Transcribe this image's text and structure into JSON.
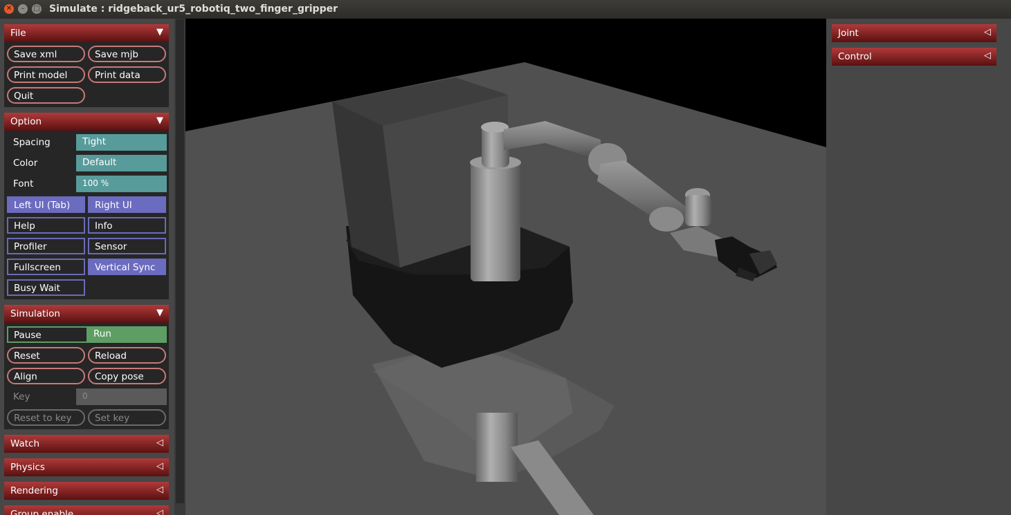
{
  "window": {
    "title": "Simulate : ridgeback_ur5_robotiq_two_finger_gripper"
  },
  "left": {
    "file": {
      "header": "File",
      "buttons": [
        "Save xml",
        "Save mjb",
        "Print model",
        "Print data",
        "Quit"
      ]
    },
    "option": {
      "header": "Option",
      "spacing_label": "Spacing",
      "spacing_value": "Tight",
      "color_label": "Color",
      "color_value": "Default",
      "font_label": "Font",
      "font_value": "100 %",
      "toggles": [
        "Left UI (Tab)",
        "Right UI",
        "Help",
        "Info",
        "Profiler",
        "Sensor",
        "Fullscreen",
        "Vertical Sync",
        "Busy Wait"
      ]
    },
    "simulation": {
      "header": "Simulation",
      "pause": "Pause",
      "run": "Run",
      "reset": "Reset",
      "reload": "Reload",
      "align": "Align",
      "copy_pose": "Copy pose",
      "key_label": "Key",
      "key_value": "0",
      "reset_to_key": "Reset to key",
      "set_key": "Set key"
    },
    "collapsed": [
      "Watch",
      "Physics",
      "Rendering",
      "Group enable"
    ]
  },
  "right": {
    "sections": [
      "Joint",
      "Control"
    ]
  },
  "colors": {
    "section_header": "#8f2828",
    "selected": "#589b9b",
    "toggle_on": "#6b6bbf",
    "run": "#5e9e64"
  },
  "icons": {
    "expanded": "triangle-down-icon",
    "collapsed": "triangle-left-icon"
  }
}
